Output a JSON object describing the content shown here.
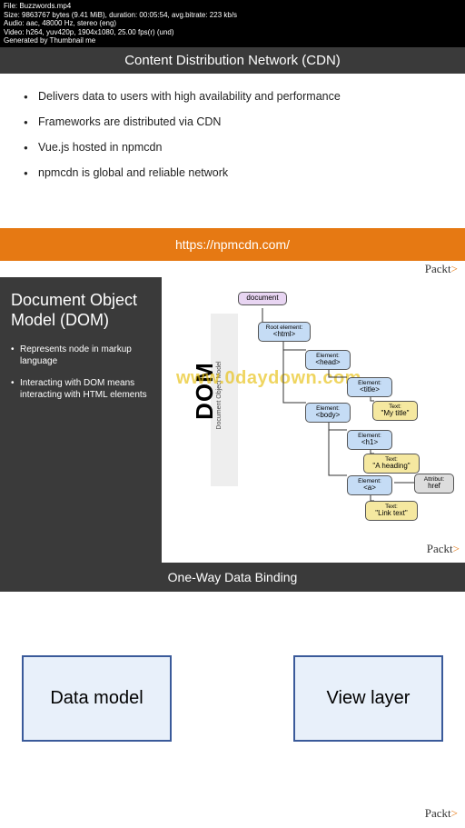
{
  "meta": {
    "line1": "File: Buzzwords.mp4",
    "line2": "Size: 9863767 bytes (9.41 MiB), duration: 00:05:54, avg.bitrate: 223 kb/s",
    "line3": "Audio: aac, 48000 Hz, stereo (eng)",
    "line4": "Video: h264, yuv420p, 1904x1080, 25.00 fps(r) (und)",
    "line5": "Generated by Thumbnail me"
  },
  "slide1": {
    "title": "Content Distribution Network (CDN)",
    "bullets": [
      "Delivers data to users with high availability and performance",
      "Frameworks are distributed via CDN",
      "Vue.js hosted in npmcdn",
      "npmcdn is global and reliable network"
    ]
  },
  "orange": {
    "url": "https://npmcdn.com/"
  },
  "brand": "Packt",
  "slide2": {
    "title": "Document Object Model (DOM)",
    "bullets": [
      "Represents node in markup language",
      "Interacting with DOM means interacting with HTML elements"
    ],
    "dom_big": "DOM",
    "dom_sub": "Document Object Model",
    "nodes": {
      "doc": {
        "lbl": "",
        "txt": "document"
      },
      "html": {
        "lbl": "Root element:",
        "txt": "<html>"
      },
      "head": {
        "lbl": "Element:",
        "txt": "<head>"
      },
      "title": {
        "lbl": "Element:",
        "txt": "<title>"
      },
      "ttxt": {
        "lbl": "Text:",
        "txt": "\"My title\""
      },
      "body": {
        "lbl": "Element:",
        "txt": "<body>"
      },
      "h1": {
        "lbl": "Element:",
        "txt": "<h1>"
      },
      "htxt": {
        "lbl": "Text:",
        "txt": "\"A heading\""
      },
      "a": {
        "lbl": "Element:",
        "txt": "<a>"
      },
      "href": {
        "lbl": "Attribut:",
        "txt": "href"
      },
      "atxt": {
        "lbl": "Text:",
        "txt": "\"Link text\""
      }
    }
  },
  "watermark": "www.0daydown.com",
  "slide3": {
    "title": "One-Way Data Binding",
    "left": "Data model",
    "right": "View layer"
  }
}
